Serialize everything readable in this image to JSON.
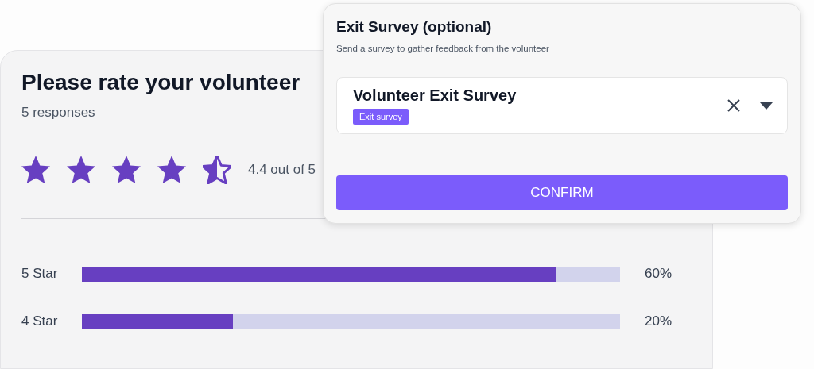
{
  "rating_card": {
    "title": "Please rate your volunteer",
    "responses": "5 responses",
    "stars": 4.5,
    "rating_text": "4.4 out of 5",
    "breakdown": [
      {
        "label": "5 Star",
        "level": 0.88,
        "percent": "60%"
      },
      {
        "label": "4 Star",
        "level": 0.28,
        "percent": "20%"
      }
    ]
  },
  "exit_survey_dialog": {
    "title": "Exit Survey (optional)",
    "subtitle": "Send a survey to gather feedback from the volunteer",
    "select": {
      "value": "Volunteer Exit Survey",
      "tag": "Exit survey"
    },
    "confirm_button": "CONFIRM"
  }
}
